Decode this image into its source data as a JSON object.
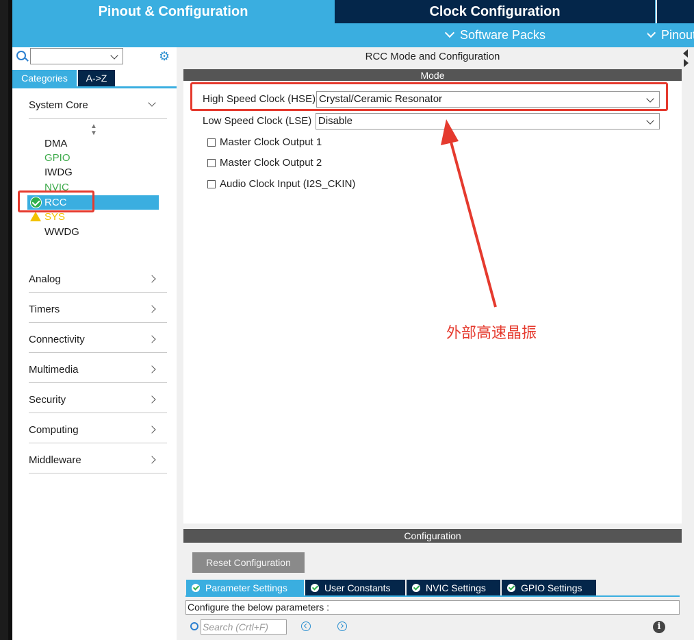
{
  "top_tabs": {
    "pinout": "Pinout & Configuration",
    "clock": "Clock Configuration"
  },
  "menu": {
    "software_packs": "Software Packs",
    "pinout": "Pinout"
  },
  "sidebar": {
    "tabs": {
      "categories": "Categories",
      "az": "A->Z"
    },
    "search_value": "",
    "system_core": {
      "label": "System Core",
      "items": [
        {
          "label": "DMA",
          "color": "#1a1a1a"
        },
        {
          "label": "GPIO",
          "color": "#3daa4a"
        },
        {
          "label": "IWDG",
          "color": "#1a1a1a"
        },
        {
          "label": "NVIC",
          "color": "#3daa4a"
        },
        {
          "label": "RCC",
          "color": "#ffffff",
          "status": "check-icon"
        },
        {
          "label": "SYS",
          "color": "#f2c200",
          "status": "warning-icon"
        },
        {
          "label": "WWDG",
          "color": "#1a1a1a"
        }
      ]
    },
    "categories": [
      "Analog",
      "Timers",
      "Connectivity",
      "Multimedia",
      "Security",
      "Computing",
      "Middleware"
    ]
  },
  "main": {
    "title": "RCC Mode and Configuration",
    "mode_header": "Mode",
    "hse": {
      "label": "High Speed Clock (HSE)",
      "value": "Crystal/Ceramic Resonator"
    },
    "lse": {
      "label": "Low Speed Clock (LSE)",
      "value": "Disable"
    },
    "checkboxes": [
      {
        "label": "Master Clock Output 1",
        "checked": false
      },
      {
        "label": "Master Clock Output 2",
        "checked": false
      },
      {
        "label": "Audio Clock Input (I2S_CKIN)",
        "checked": false
      }
    ],
    "annotation": "外部高速晶振"
  },
  "config": {
    "header": "Configuration",
    "reset_label": "Reset Configuration",
    "tabs": [
      "Parameter Settings",
      "User Constants",
      "NVIC Settings",
      "GPIO Settings"
    ],
    "message": "Configure the below parameters :",
    "search_placeholder": "Search (Crtl+F)"
  },
  "colors": {
    "accent": "#3aaee0",
    "navy": "#04264a",
    "annotation_red": "#e53a2e"
  }
}
